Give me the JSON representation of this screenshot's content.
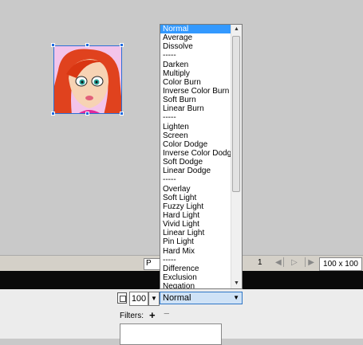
{
  "canvas": {
    "sprite": "character-portrait"
  },
  "statusbar": {
    "left_field": "P",
    "frame": "1",
    "size": "100 x 100"
  },
  "layer_panel": {
    "opacity": "100",
    "blend_mode": "Normal",
    "filters_label": "Filters:"
  },
  "blend_dropdown": {
    "items": [
      "Normal",
      "Average",
      "Dissolve",
      "-----",
      "Darken",
      "Multiply",
      "Color Burn",
      "Inverse Color Burn",
      "Soft Burn",
      "Linear Burn",
      "-----",
      "Lighten",
      "Screen",
      "Color Dodge",
      "Inverse Color Dodge",
      "Soft Dodge",
      "Linear Dodge",
      "-----",
      "Overlay",
      "Soft Light",
      "Fuzzy Light",
      "Hard Light",
      "Vivid Light",
      "Linear Light",
      "Pin Light",
      "Hard Mix",
      "-----",
      "Difference",
      "Exclusion",
      "Negation"
    ],
    "selected": "Normal"
  }
}
